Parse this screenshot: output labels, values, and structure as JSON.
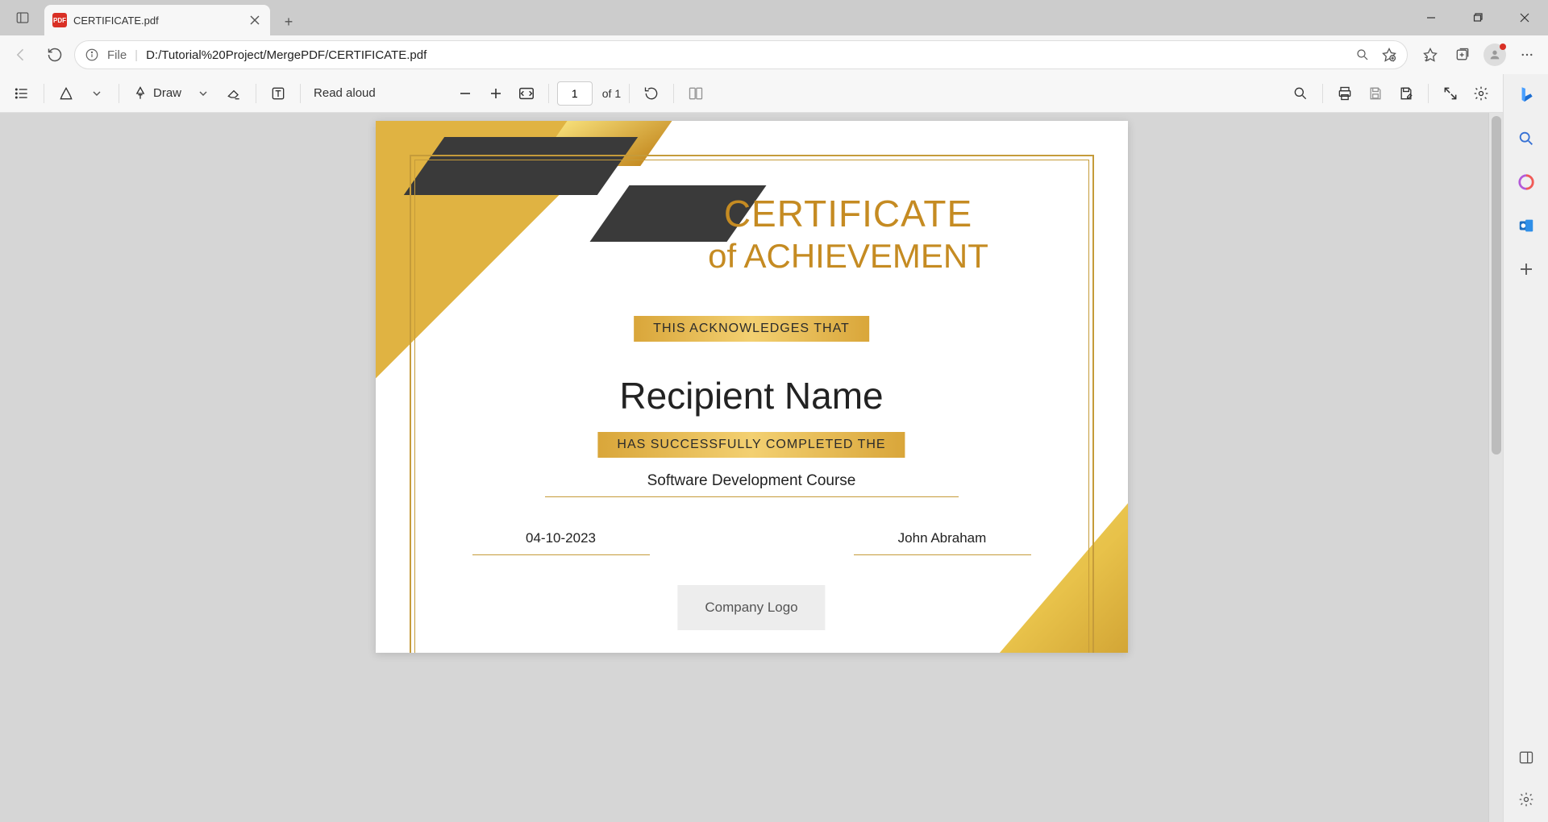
{
  "tab": {
    "title": "CERTIFICATE.pdf"
  },
  "addressbar": {
    "file_label": "File",
    "url": "D:/Tutorial%20Project/MergePDF/CERTIFICATE.pdf"
  },
  "pdf_toolbar": {
    "draw_label": "Draw",
    "read_aloud_label": "Read aloud",
    "page_current": "1",
    "page_of": "of 1"
  },
  "certificate": {
    "title_line1": "CERTIFICATE",
    "title_line2": "of ACHIEVEMENT",
    "ack_text": "THIS ACKNOWLEDGES THAT",
    "recipient": "Recipient Name",
    "completed_text": "HAS SUCCESSFULLY COMPLETED THE",
    "course": "Software Development Course",
    "date": "04-10-2023",
    "signer": "John Abraham",
    "logo_text": "Company Logo"
  },
  "colors": {
    "gold": "#c59b3a"
  }
}
